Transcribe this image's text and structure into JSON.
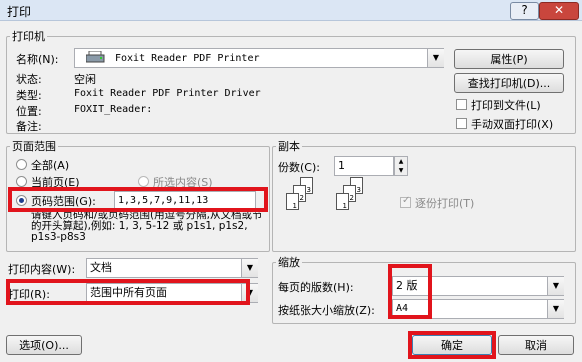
{
  "window": {
    "title": "打印",
    "help": "?",
    "close": "✕"
  },
  "printer": {
    "group_label": "打印机",
    "name_label": "名称(N):",
    "name_value": "Foxit Reader PDF Printer",
    "status_label": "状态:",
    "status_value": "空闲",
    "type_label": "类型:",
    "type_value": "Foxit Reader PDF Printer Driver",
    "location_label": "位置:",
    "location_value": "FOXIT_Reader:",
    "comment_label": "备注:",
    "properties_btn": "属性(P)",
    "find_btn": "查找打印机(D)...",
    "print_to_file": "打印到文件(L)",
    "manual_duplex": "手动双面打印(X)"
  },
  "page_range": {
    "group_label": "页面范围",
    "all": "全部(A)",
    "current": "当前页(E)",
    "selection": "所选内容(S)",
    "pages_label": "页码范围(G):",
    "pages_value": "1,3,5,7,9,11,13",
    "hint": "请键入页码和/或页码范围(用逗号分隔,从文档或节的开头算起),例如: 1, 3, 5-12 或 p1s1, p1s2, p1s3-p8s3"
  },
  "copies": {
    "group_label": "副本",
    "count_label": "份数(C):",
    "count_value": "1",
    "collate": "逐份打印(T)"
  },
  "print_what": {
    "label": "打印内容(W):",
    "value": "文档"
  },
  "print": {
    "label": "打印(R):",
    "value": "范围中所有页面"
  },
  "zoom": {
    "group_label": "缩放",
    "pages_per_sheet_label": "每页的版数(H):",
    "pages_per_sheet_value": "2 版",
    "scale_label": "按纸张大小缩放(Z):",
    "scale_value": "A4"
  },
  "footer": {
    "options": "选项(O)...",
    "ok": "确定",
    "cancel": "取消"
  },
  "colors": {
    "highlight": "#e1141c",
    "close": "#c9463d"
  }
}
